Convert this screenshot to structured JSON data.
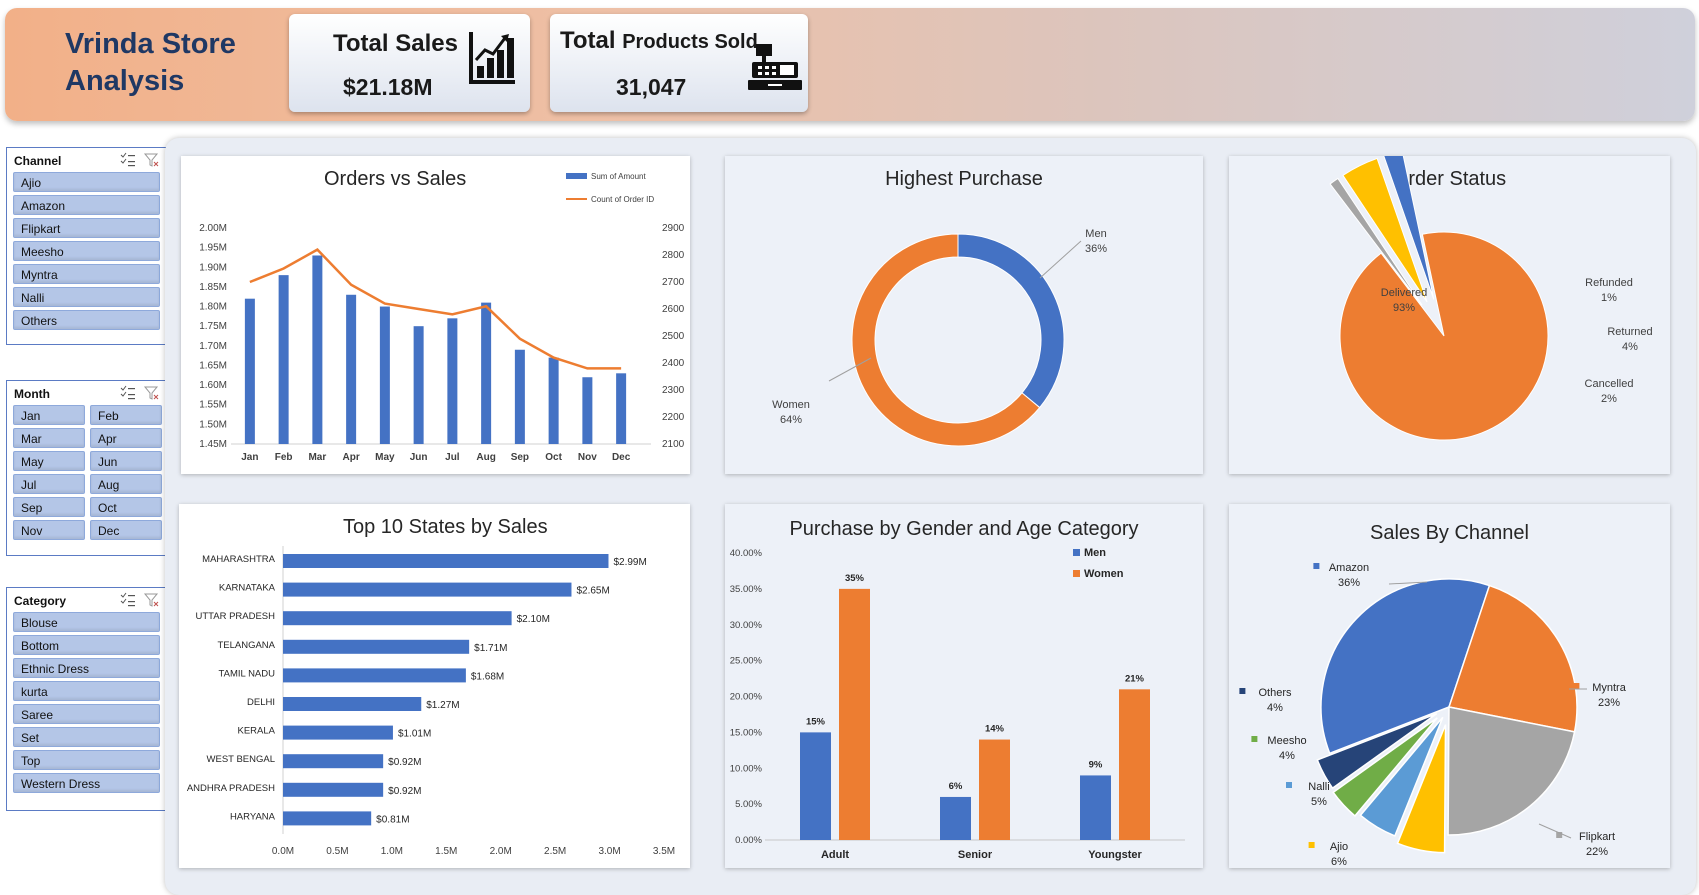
{
  "header": {
    "brand_line1": "Vrinda Store",
    "brand_line2": "Analysis",
    "kpis": [
      {
        "title": "Total Sales",
        "value": "$21.18M",
        "icon": "bar-chart-icon"
      },
      {
        "title_bold": "Total",
        "title_rest": "Products Sold",
        "value": "31,047",
        "icon": "cash-register-icon"
      }
    ]
  },
  "slicers": {
    "channel": {
      "title": "Channel",
      "items": [
        "Ajio",
        "Amazon",
        "Flipkart",
        "Meesho",
        "Myntra",
        "Nalli",
        "Others"
      ]
    },
    "month": {
      "title": "Month",
      "items": [
        "Jan",
        "Feb",
        "Mar",
        "Apr",
        "May",
        "Jun",
        "Jul",
        "Aug",
        "Sep",
        "Oct",
        "Nov",
        "Dec"
      ]
    },
    "category": {
      "title": "Category",
      "items": [
        "Blouse",
        "Bottom",
        "Ethnic Dress",
        "kurta",
        "Saree",
        "Set",
        "Top",
        "Western Dress"
      ]
    }
  },
  "colors": {
    "blue": "#4472c4",
    "orange": "#ed7d31",
    "gray": "#a5a5a5",
    "gold": "#ffc000",
    "lightblue": "#5b9bd5",
    "green": "#70ad47",
    "navy": "#264478"
  },
  "chart_data": [
    {
      "id": "orders_vs_sales",
      "type": "bar",
      "title": "Orders vs Sales",
      "categories": [
        "Jan",
        "Feb",
        "Mar",
        "Apr",
        "May",
        "Jun",
        "Jul",
        "Aug",
        "Sep",
        "Oct",
        "Nov",
        "Dec"
      ],
      "series": [
        {
          "name": "Sum of Amount",
          "type": "bar",
          "axis": "left",
          "values": [
            1.82,
            1.88,
            1.93,
            1.83,
            1.8,
            1.75,
            1.77,
            1.81,
            1.69,
            1.67,
            1.62,
            1.63
          ]
        },
        {
          "name": "Count of Order ID",
          "type": "line",
          "axis": "right",
          "values": [
            2700,
            2750,
            2820,
            2690,
            2620,
            2600,
            2580,
            2610,
            2490,
            2420,
            2380,
            2380
          ]
        }
      ],
      "y_left": {
        "min": 1.45,
        "max": 2.0,
        "ticks": [
          "1.45M",
          "1.50M",
          "1.55M",
          "1.60M",
          "1.65M",
          "1.70M",
          "1.75M",
          "1.80M",
          "1.85M",
          "1.90M",
          "1.95M",
          "2.00M"
        ]
      },
      "y_right": {
        "min": 2100,
        "max": 2900,
        "ticks": [
          "2100",
          "2200",
          "2300",
          "2400",
          "2500",
          "2600",
          "2700",
          "2800",
          "2900"
        ]
      },
      "legend": "top-right"
    },
    {
      "id": "highest_purchase",
      "type": "pie",
      "title": "Highest Purchase",
      "donut": true,
      "slices": [
        {
          "label": "Men",
          "value": 36,
          "pct": "36%"
        },
        {
          "label": "Women",
          "value": 64,
          "pct": "64%"
        }
      ]
    },
    {
      "id": "order_status",
      "type": "pie",
      "title": "Order Status",
      "slices": [
        {
          "label": "Delivered",
          "value": 93,
          "pct": "93%"
        },
        {
          "label": "Refunded",
          "value": 1,
          "pct": "1%"
        },
        {
          "label": "Returned",
          "value": 4,
          "pct": "4%"
        },
        {
          "label": "Cancelled",
          "value": 2,
          "pct": "2%"
        }
      ]
    },
    {
      "id": "top_states",
      "type": "bar",
      "orientation": "horizontal",
      "title": "Top 10 States by Sales",
      "categories": [
        "MAHARASHTRA",
        "KARNATAKA",
        "UTTAR PRADESH",
        "TELANGANA",
        "TAMIL NADU",
        "DELHI",
        "KERALA",
        "WEST BENGAL",
        "ANDHRA PRADESH",
        "HARYANA"
      ],
      "values": [
        2.99,
        2.65,
        2.1,
        1.71,
        1.68,
        1.27,
        1.01,
        0.92,
        0.92,
        0.81
      ],
      "value_labels": [
        "$2.99M",
        "$2.65M",
        "$2.10M",
        "$1.71M",
        "$1.68M",
        "$1.27M",
        "$1.01M",
        "$0.92M",
        "$0.92M",
        "$0.81M"
      ],
      "xlim": [
        0,
        3.5
      ],
      "x_ticks": [
        "0.0M",
        "0.5M",
        "1.0M",
        "1.5M",
        "2.0M",
        "2.5M",
        "3.0M",
        "3.5M"
      ]
    },
    {
      "id": "gender_age",
      "type": "bar",
      "title": "Purchase by Gender and Age Category",
      "categories": [
        "Adult",
        "Senior",
        "Youngster"
      ],
      "series": [
        {
          "name": "Men",
          "values": [
            15,
            6,
            9
          ],
          "labels": [
            "15%",
            "6%",
            "9%"
          ]
        },
        {
          "name": "Women",
          "values": [
            35,
            14,
            21
          ],
          "labels": [
            "35%",
            "14%",
            "21%"
          ]
        }
      ],
      "ylim": [
        0,
        40
      ],
      "y_ticks": [
        "0.00%",
        "5.00%",
        "10.00%",
        "15.00%",
        "20.00%",
        "25.00%",
        "30.00%",
        "35.00%",
        "40.00%"
      ],
      "legend": "top-right"
    },
    {
      "id": "sales_by_channel",
      "type": "pie",
      "title": "Sales By Channel",
      "slices": [
        {
          "label": "Amazon",
          "value": 36,
          "pct": "36%"
        },
        {
          "label": "Myntra",
          "value": 23,
          "pct": "23%"
        },
        {
          "label": "Flipkart",
          "value": 22,
          "pct": "22%"
        },
        {
          "label": "Ajio",
          "value": 6,
          "pct": "6%"
        },
        {
          "label": "Nalli",
          "value": 5,
          "pct": "5%"
        },
        {
          "label": "Meesho",
          "value": 4,
          "pct": "4%"
        },
        {
          "label": "Others",
          "value": 4,
          "pct": "4%"
        }
      ]
    }
  ]
}
